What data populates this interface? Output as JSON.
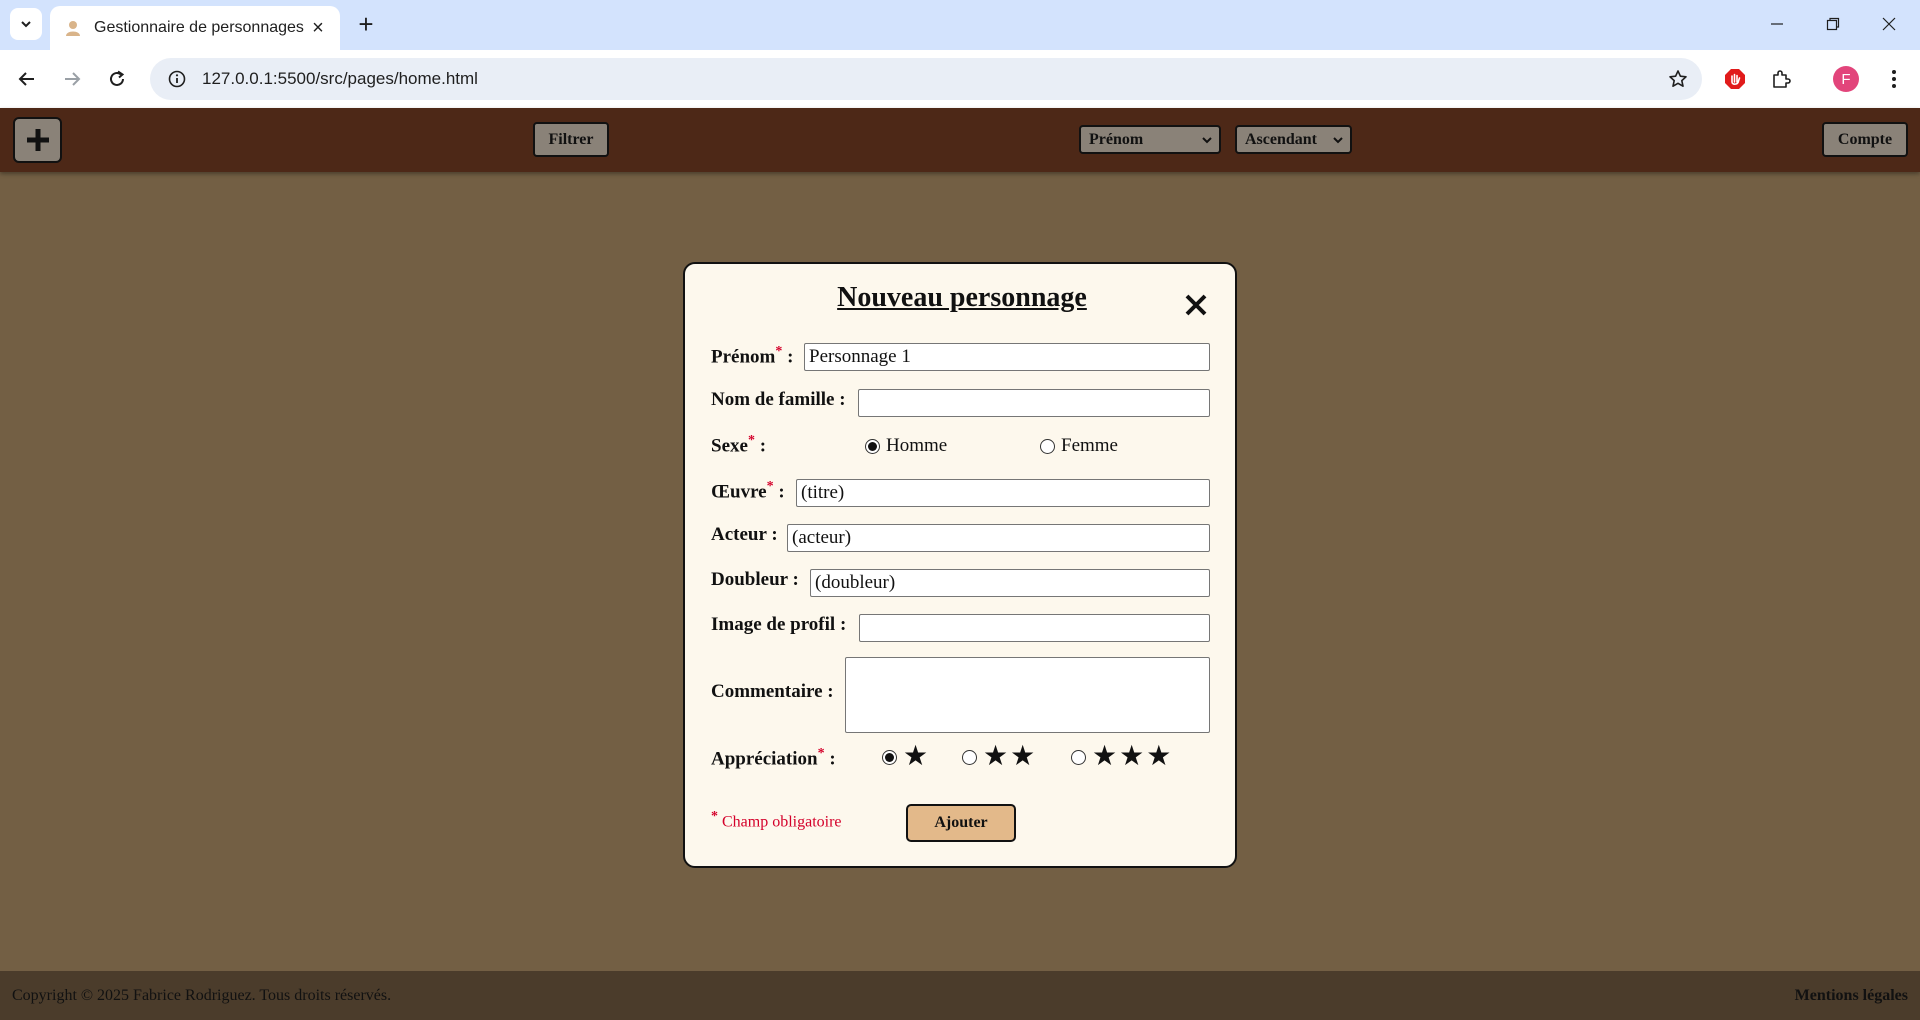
{
  "browser": {
    "tab_title": "Gestionnaire de personnages",
    "url": "127.0.0.1:5500/src/pages/home.html",
    "profile_initial": "F"
  },
  "header": {
    "filter_label": "Filtrer",
    "sort_field": "Prénom",
    "sort_order": "Ascendant",
    "account_label": "Compte"
  },
  "modal": {
    "title": "Nouveau personnage",
    "fields": {
      "first_name_label": "Prénom",
      "first_name_value": "Personnage 1",
      "last_name_label": "Nom de famille :",
      "last_name_value": "",
      "sex_label": "Sexe",
      "sex_male": "Homme",
      "sex_female": "Femme",
      "work_label": "Œuvre",
      "work_value": "(titre)",
      "actor_label": "Acteur :",
      "actor_value": "(acteur)",
      "dubber_label": "Doubleur :",
      "dubber_value": "(doubleur)",
      "image_label": "Image de profil :",
      "image_value": "",
      "comment_label": "Commentaire :",
      "comment_value": "",
      "rating_label": "Appréciation",
      "rating_1": "★",
      "rating_2": "★★",
      "rating_3": "★★★"
    },
    "required_marker": "*",
    "field_suffix": " :",
    "required_note": "Champ obligatoire",
    "submit_label": "Ajouter",
    "selected_sex": "Homme",
    "selected_rating": 1
  },
  "footer": {
    "copyright": "Copyright © 2025 Fabrice Rodriguez. Tous droits réservés.",
    "legal_link": "Mentions légales"
  },
  "colors": {
    "header_bg": "#4d2817",
    "page_bg": "#735f44",
    "modal_bg": "#fdf8ed",
    "submit_bg": "#e3b98a",
    "required": "#d4002a"
  }
}
